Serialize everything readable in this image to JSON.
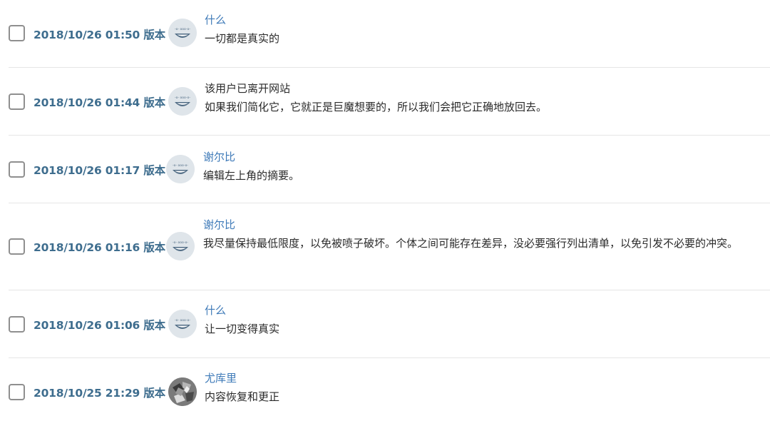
{
  "revisions": [
    {
      "date": "2018/10/26 01:50 版本",
      "author": "什么",
      "summary": "一切都是真实的",
      "avatar": "default-avatar"
    },
    {
      "date": "2018/10/26 01:44 版本",
      "author": "该用户已离开网站",
      "summary": "如果我们简化它，它就正是巨魔想要的，所以我们会把它正确地放回去。",
      "avatar": "default-avatar"
    },
    {
      "date": "2018/10/26 01:17 版本",
      "author": "谢尔比",
      "summary": "编辑左上角的摘要。",
      "avatar": "default-avatar"
    },
    {
      "date": "2018/10/26 01:16 版本",
      "author": "谢尔比",
      "summary": "我尽量保持最低限度，以免被喷子破坏。个体之间可能存在差异，没必要强行列出清单，以免引发不必要的冲突。",
      "avatar": "default-avatar"
    },
    {
      "date": "2018/10/26 01:06 版本",
      "author": "什么",
      "summary": "让一切变得真实",
      "avatar": "default-avatar"
    },
    {
      "date": "2018/10/25 21:29 版本",
      "author": "尤库里",
      "summary": "内容恢复和更正",
      "avatar": "photo-avatar"
    }
  ],
  "colors": {
    "link": "#3e7ab8",
    "date": "#3e6d8e",
    "divider": "#e6e6e6"
  }
}
